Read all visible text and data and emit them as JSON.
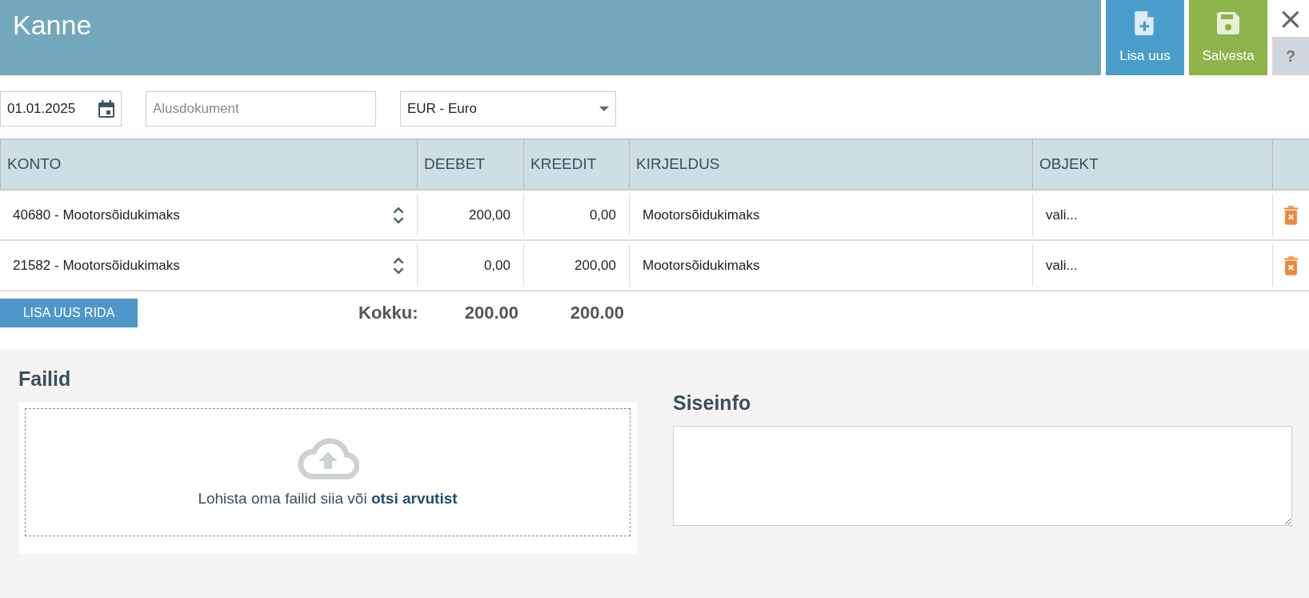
{
  "window": {
    "title": "Kanne"
  },
  "header_buttons": [
    {
      "kind": "new",
      "label": "Lisa uus"
    },
    {
      "kind": "save",
      "label": "Salvesta"
    }
  ],
  "close_button": {
    "label": "×"
  },
  "help_button": {
    "label": "?"
  },
  "form": {
    "date": {
      "value": "01.01.2025"
    },
    "document": {
      "placeholder": "Alusdokument"
    },
    "currency": {
      "value": "EUR - Euro"
    }
  },
  "table": {
    "columns": [
      "KONTO",
      "DEEBET",
      "KREEDIT",
      "KIRJELDUS",
      "OBJEKT"
    ],
    "rows": [
      {
        "account": "40680 - Mootorsõidukimaks",
        "debit": "200,00",
        "credit": "0,00",
        "description": "Mootorsõidukimaks",
        "object": "vali..."
      },
      {
        "account": "21582 - Mootorsõidukimaks",
        "debit": "0,00",
        "credit": "200,00",
        "description": "Mootorsõidukimaks",
        "object": "vali..."
      }
    ]
  },
  "add_row_button": {
    "label": "LISA UUS RIDA"
  },
  "totals": {
    "label": "Kokku:",
    "debit": "200.00",
    "credit": "200.00"
  },
  "files": {
    "title": "Failid",
    "text": "Lohista oma failid siia või",
    "link": "otsi arvutist"
  },
  "internal_info": {
    "title": "Siseinfo"
  }
}
